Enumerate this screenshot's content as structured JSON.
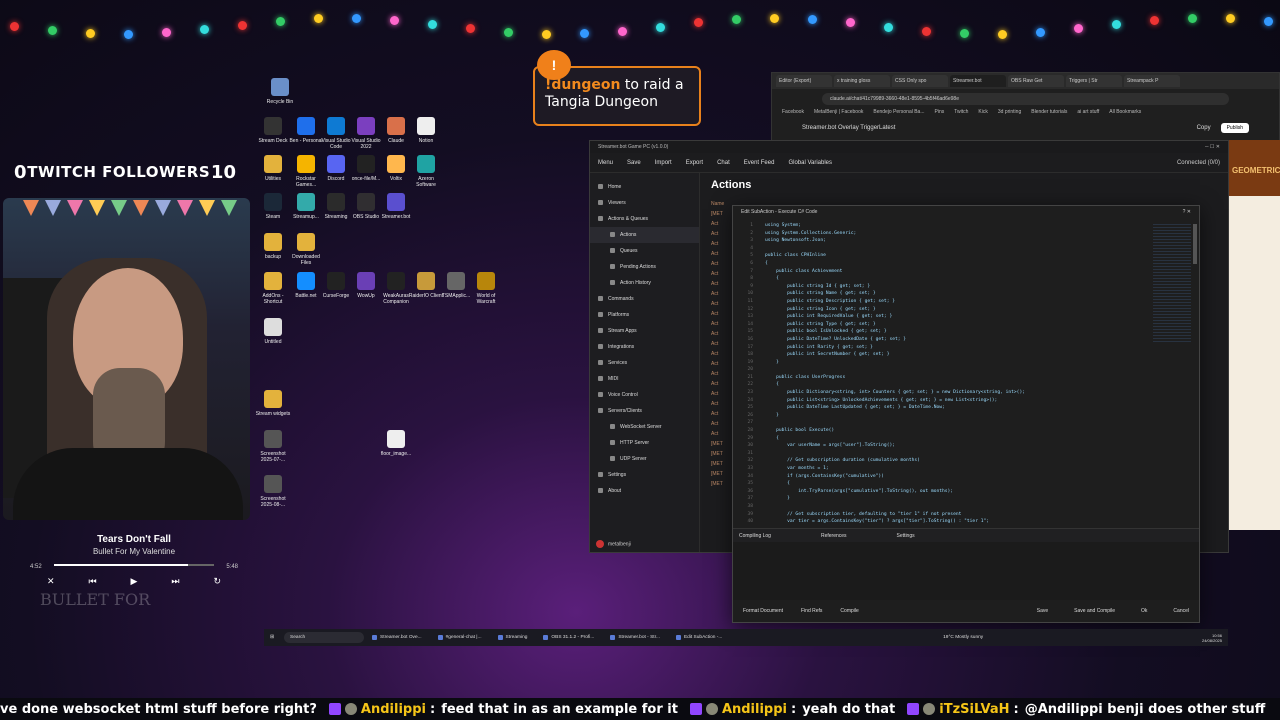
{
  "overlay": {
    "followers_left": "0",
    "followers_title": "TWITCH FOLLOWERS",
    "followers_right": "10",
    "dungeon_cmd": "!dungeon",
    "dungeon_line1": " to raid a",
    "dungeon_line2": "Tangia Dungeon",
    "now_playing": {
      "song": "Tears Don't Fall",
      "artist": "Bullet For My Valentine",
      "elapsed": "4:52",
      "duration": "5:48",
      "progress": 0.84,
      "watermark": "BULLET FOR"
    }
  },
  "desktop_icons": [
    {
      "label": "Recycle Bin",
      "color": "#6a8fc8"
    },
    {
      "label": "Stream Deck",
      "color": "#333"
    },
    {
      "label": "Ben - Personal",
      "color": "#1f6feb"
    },
    {
      "label": "Visual Studio Code",
      "color": "#0e7ad3"
    },
    {
      "label": "Visual Studio 2022",
      "color": "#7b3fbf"
    },
    {
      "label": "Claude",
      "color": "#d9704a"
    },
    {
      "label": "Notion",
      "color": "#eee"
    },
    {
      "label": "Utilities",
      "color": "#e3b23c"
    },
    {
      "label": "Rockstar Games...",
      "color": "#f5b400"
    },
    {
      "label": "Discord",
      "color": "#5865f2"
    },
    {
      "label": "once-file/M...",
      "color": "#222"
    },
    {
      "label": "Voltix",
      "color": "#ffb74d"
    },
    {
      "label": "Azeron Software",
      "color": "#1fa3a3"
    },
    {
      "label": "Steam",
      "color": "#1b2838"
    },
    {
      "label": "Streamup...",
      "color": "#3aa"
    },
    {
      "label": "Streaming",
      "color": "#2b2b2b"
    },
    {
      "label": "OBS Studio",
      "color": "#302e31"
    },
    {
      "label": "Streamer.bot",
      "color": "#5a4fcf"
    },
    {
      "label": "backup",
      "color": "#e3b23c"
    },
    {
      "label": "Downloaded Files",
      "color": "#e3b23c"
    },
    {
      "label": "AddOns - Shortcut",
      "color": "#e3b23c"
    },
    {
      "label": "Battle.net",
      "color": "#148eff"
    },
    {
      "label": "CurseForge",
      "color": "#222"
    },
    {
      "label": "WowUp",
      "color": "#6a3fb5"
    },
    {
      "label": "WeakAuras Companion",
      "color": "#222"
    },
    {
      "label": "RaiderIO Client",
      "color": "#c79a3a"
    },
    {
      "label": "TSMApplic...",
      "color": "#666"
    },
    {
      "label": "World of Warcraft",
      "color": "#b8860b"
    },
    {
      "label": "Untitled",
      "color": "#ddd"
    },
    {
      "label": "Stream widgets",
      "color": "#e3b23c"
    },
    {
      "label": "Screenshot 2025-07-...",
      "color": "#555"
    },
    {
      "label": "Screenshot 2025-08-...",
      "color": "#555"
    },
    {
      "label": "floor_image...",
      "color": "#eee"
    }
  ],
  "browser": {
    "tabs": [
      "Editor (Export)",
      "x training gloss",
      "CSS Only spo",
      "Streamer.bot",
      "OBS Raw Get",
      "Triggers | Str",
      "Streampack P"
    ],
    "url": "claude.ai/chat/41c79989-3660-48e1-8595-4b5f46ad6e98e",
    "bookmarks": [
      "Facebook",
      "MetalBenji | Facebook",
      "Bendejo Personal Ba...",
      "Pins",
      "Twitch",
      "Kick",
      "3d printing",
      "Blender tutorials",
      "ai art stuff",
      "All Bookmarks"
    ],
    "page_title": "Streamer.bot Overlay Trigger",
    "version": "Latest",
    "copy": "Copy",
    "publish": "Publish",
    "side_panel_text": "GEOMETRIC"
  },
  "streamerbot": {
    "title": "Streamer.bot Game PC (v1.0.0)",
    "menu": [
      "Menu",
      "Save",
      "Import",
      "Export",
      "Chat",
      "Event Feed",
      "Global Variables"
    ],
    "connected": "Connected (0/0)",
    "page_title": "Actions",
    "nav": [
      {
        "label": "Home",
        "sub": false
      },
      {
        "label": "Viewers",
        "sub": false
      },
      {
        "label": "Actions & Queues",
        "sub": false
      },
      {
        "label": "Actions",
        "sub": true,
        "active": true
      },
      {
        "label": "Queues",
        "sub": true
      },
      {
        "label": "Pending Actions",
        "sub": true
      },
      {
        "label": "Action History",
        "sub": true
      },
      {
        "label": "Commands",
        "sub": false
      },
      {
        "label": "Platforms",
        "sub": false
      },
      {
        "label": "Stream Apps",
        "sub": false
      },
      {
        "label": "Integrations",
        "sub": false
      },
      {
        "label": "Services",
        "sub": false
      },
      {
        "label": "MIDI",
        "sub": false
      },
      {
        "label": "Voice Control",
        "sub": false
      },
      {
        "label": "Servers/Clients",
        "sub": false
      },
      {
        "label": "WebSocket Server",
        "sub": true
      },
      {
        "label": "HTTP Server",
        "sub": true
      },
      {
        "label": "UDP Server",
        "sub": true
      },
      {
        "label": "Settings",
        "sub": false
      },
      {
        "label": "About",
        "sub": false
      }
    ],
    "user": "metalbenji",
    "action_rows": [
      "Name",
      "[MET",
      "Act",
      "Act",
      "Act",
      "Act",
      "Act",
      "Act",
      "Act",
      "Act",
      "Act",
      "Act",
      "Act",
      "Act",
      "Act",
      "Act",
      "Act",
      "Act",
      "Act",
      "Act",
      "Act",
      "Act",
      "Act",
      "Act",
      "[MET",
      "[MET",
      "[MET",
      "[MET",
      "[MET"
    ]
  },
  "editor": {
    "title": "Edit SubAction - Execute C# Code",
    "code_lines": [
      "using System;",
      "using System.Collections.Generic;",
      "using Newtonsoft.Json;",
      "",
      "public class CPHInline",
      "{",
      "    public class Achievement",
      "    {",
      "        public string Id { get; set; }",
      "        public string Name { get; set; }",
      "        public string Description { get; set; }",
      "        public string Icon { get; set; }",
      "        public int RequiredValue { get; set; }",
      "        public string Type { get; set; }",
      "        public bool IsUnlocked { get; set; }",
      "        public DateTime? UnlockedDate { get; set; }",
      "        public int Rarity { get; set; }",
      "        public int SecretNumber { get; set; }",
      "    }",
      "",
      "    public class UserProgress",
      "    {",
      "        public Dictionary<string, int> Counters { get; set; } = new Dictionary<string, int>();",
      "        public List<string> UnlockedAchievements { get; set; } = new List<string>();",
      "        public DateTime LastUpdated { get; set; } = DateTime.Now;",
      "    }",
      "",
      "    public bool Execute()",
      "    {",
      "        var userName = args[\"user\"].ToString();",
      "",
      "        // Get subscription duration (cumulative months)",
      "        var months = 1;",
      "        if (args.ContainsKey(\"cumulative\"))",
      "        {",
      "            int.TryParse(args[\"cumulative\"].ToString(), out months);",
      "        }",
      "",
      "        // Get subscription tier, defaulting to \"tier 1\" if not present",
      "        var tier = args.ContainsKey(\"tier\") ? args[\"tier\"].ToString() : \"tier 1\";"
    ],
    "bottom_tabs": [
      "Compiling Log",
      "References",
      "Settings"
    ],
    "buttons_left": [
      "Format Document",
      "Find Refs",
      "Compile"
    ],
    "buttons_right": [
      "Save",
      "Save and Compile",
      "Ok",
      "Cancel"
    ]
  },
  "taskbar": {
    "search": "Search",
    "apps": [
      "Streamer.bot Ove...",
      "#general-chat |...",
      "Streaming",
      "OBS 31.1.2 - Profi...",
      "Streamer.bot - Str...",
      "Edit SubAction -..."
    ],
    "weather": "19°C Mostly sunny",
    "time": "10:56",
    "date": "24/08/2025"
  },
  "chat": [
    {
      "user": "",
      "text": "ve done websocket html stuff before right?"
    },
    {
      "user": "Andilippi",
      "text": "feed that in as an example for it"
    },
    {
      "user": "Andilippi",
      "text": "yeah do that"
    },
    {
      "user": "iTzSiLVaH",
      "text": "@Andilippi benji does other stuff"
    }
  ]
}
